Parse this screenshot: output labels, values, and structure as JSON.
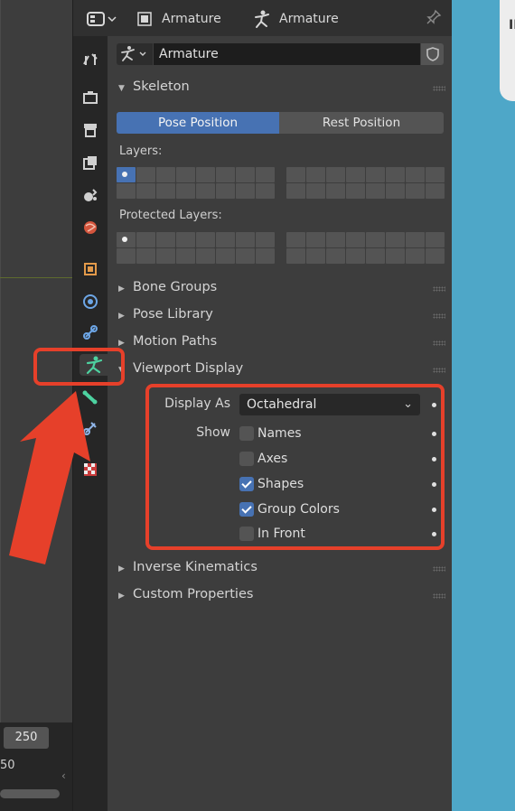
{
  "header": {
    "context_object": "Armature",
    "context_data": "Armature"
  },
  "datablock": {
    "name": "Armature"
  },
  "skeleton": {
    "title": "Skeleton",
    "pose_position": "Pose Position",
    "rest_position": "Rest Position",
    "layers_label": "Layers:",
    "protected_layers_label": "Protected Layers:"
  },
  "panels": {
    "bone_groups": "Bone Groups",
    "pose_library": "Pose Library",
    "motion_paths": "Motion Paths",
    "viewport_display": "Viewport Display",
    "inverse_kinematics": "Inverse Kinematics",
    "custom_properties": "Custom Properties"
  },
  "viewport_display": {
    "display_as_label": "Display As",
    "display_as_value": "Octahedral",
    "show_label": "Show",
    "options": [
      {
        "label": "Names",
        "checked": false
      },
      {
        "label": "Axes",
        "checked": false
      },
      {
        "label": "Shapes",
        "checked": true
      },
      {
        "label": "Group Colors",
        "checked": true
      },
      {
        "label": "In Front",
        "checked": false
      }
    ]
  },
  "timeline": {
    "frame_end": "250",
    "frame_current": "50"
  },
  "tabs": [
    {
      "name": "tool-tab-icon",
      "active": false
    },
    {
      "name": "render-tab-icon",
      "active": false
    },
    {
      "name": "output-tab-icon",
      "active": false
    },
    {
      "name": "view-layer-tab-icon",
      "active": false
    },
    {
      "name": "scene-tab-icon",
      "active": false
    },
    {
      "name": "world-tab-icon",
      "active": false
    },
    {
      "name": "object-tab-icon",
      "active": false
    },
    {
      "name": "modifier-tab-icon",
      "active": false
    },
    {
      "name": "physics-tab-icon",
      "active": false
    },
    {
      "name": "armature-data-tab-icon",
      "active": true
    },
    {
      "name": "bone-tab-icon",
      "active": false
    },
    {
      "name": "bone-constraint-tab-icon",
      "active": false
    },
    {
      "name": "texture-tab-icon",
      "active": false
    }
  ],
  "colors": {
    "accent_blue": "#4772b3",
    "annotation_red": "#e6402a",
    "armature_green": "#4dd2a0",
    "background_blue": "#4ea7c8"
  }
}
